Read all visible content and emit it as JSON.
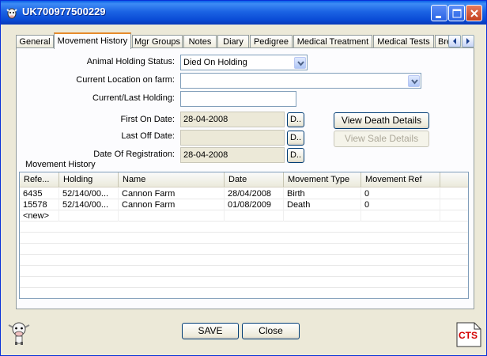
{
  "window": {
    "title": "UK700977500229"
  },
  "tabs": [
    {
      "label": "General"
    },
    {
      "label": "Movement History",
      "active": true
    },
    {
      "label": "Mgr Groups"
    },
    {
      "label": "Notes"
    },
    {
      "label": "Diary"
    },
    {
      "label": "Pedigree"
    },
    {
      "label": "Medical Treatment"
    },
    {
      "label": "Medical Tests"
    },
    {
      "label": "Bre"
    }
  ],
  "form": {
    "holding_status_label": "Animal Holding Status:",
    "holding_status_value": "Died On Holding",
    "current_location_label": "Current Location on farm:",
    "current_location_value": "",
    "current_holding_label": "Current/Last Holding:",
    "current_holding_value": "",
    "first_on_label": "First On Date:",
    "first_on_value": "28-04-2008",
    "last_off_label": "Last Off Date:",
    "last_off_value": "",
    "registration_label": "Date Of Registration:",
    "registration_value": "28-04-2008",
    "date_button_label": "D..",
    "view_death_label": "View Death Details",
    "view_sale_label": "View Sale Details"
  },
  "movement_history": {
    "title": "Movement History",
    "columns": [
      "Refe...",
      "Holding",
      "Name",
      "Date",
      "Movement Type",
      "Movement Ref"
    ],
    "rows": [
      [
        "6435",
        "52/140/00...",
        "Cannon Farm",
        "28/04/2008",
        "Birth",
        "0"
      ],
      [
        "15578",
        "52/140/00...",
        "Cannon Farm",
        "01/08/2009",
        "Death",
        "0"
      ],
      [
        "<new>",
        "",
        "",
        "",
        "",
        ""
      ]
    ]
  },
  "footer": {
    "save_label": "SAVE",
    "close_label": "Close",
    "logo_text": "CTS"
  },
  "colors": {
    "titlebar": "#0a4bd6",
    "active_tab_accent": "#e68b2c",
    "logo_red": "#d40000"
  }
}
